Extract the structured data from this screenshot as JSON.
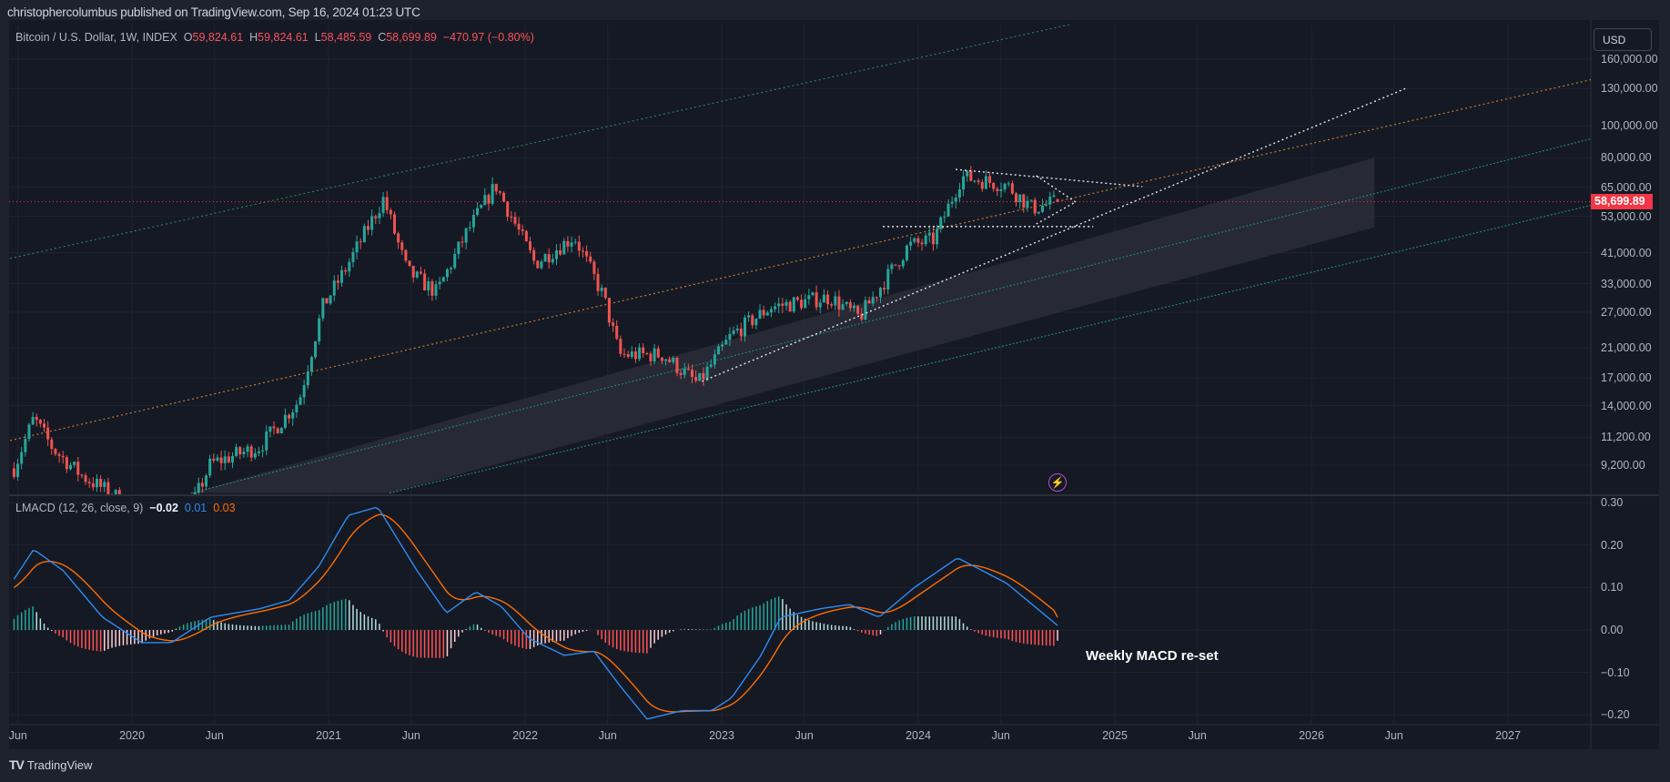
{
  "header": {
    "published": "christophercolumbus published on TradingView.com, Sep 16, 2024 01:23 UTC"
  },
  "legend": {
    "symbol": "Bitcoin / U.S. Dollar, 1W, INDEX",
    "o_label": "O",
    "o": "59,824.61",
    "h_label": "H",
    "h": "59,824.61",
    "l_label": "L",
    "l": "58,485.59",
    "c_label": "C",
    "c": "58,699.89",
    "change": "−470.97 (−0.80%)"
  },
  "currency_button": "USD",
  "current_price_tag": "58,699.89",
  "macd_legend": {
    "name": "LMACD (12, 26, close, 9)",
    "hist": "−0.02",
    "macd": "0.01",
    "signal": "0.03"
  },
  "annotation": "Weekly MACD re-set",
  "footer": {
    "logo_text": "TradingView",
    "logo_mark": "TV"
  },
  "colors": {
    "up": "#26a69a",
    "down": "#ef5350",
    "macd": "#2f8cf0",
    "signal": "#ff6d00",
    "channel_upper": "#2e7d5b",
    "orange_line": "#c77b30",
    "teal_line": "#1f7f7a",
    "band": "#2a2d38",
    "price_line": "#f23645"
  },
  "chart_data": [
    {
      "type": "candlestick",
      "title": "Bitcoin / U.S. Dollar, 1W, INDEX",
      "scale": "log",
      "y_ticks": [
        "160,000.00",
        "130,000.00",
        "100,000.00",
        "80,000.00",
        "65,000.00",
        "53,000.00",
        "41,000.00",
        "33,000.00",
        "27,000.00",
        "21,000.00",
        "17,000.00",
        "14,000.00",
        "11,200.00",
        "9,200.00"
      ],
      "y_tick_values": [
        160000,
        130000,
        100000,
        80000,
        65000,
        53000,
        41000,
        33000,
        27000,
        21000,
        17000,
        14000,
        11200,
        9200
      ],
      "x_ticks": [
        "Jun",
        "2020",
        "Jun",
        "2021",
        "Jun",
        "2022",
        "Jun",
        "2023",
        "Jun",
        "2024",
        "Jun",
        "2025",
        "Jun",
        "2026",
        "Jun",
        "2027"
      ],
      "x_tick_values": [
        2019.42,
        2020,
        2020.42,
        2021,
        2021.42,
        2022,
        2022.42,
        2023,
        2023.42,
        2024,
        2024.42,
        2025,
        2025.42,
        2026,
        2026.42,
        2027
      ],
      "price_path": [
        [
          2019.4,
          9000
        ],
        [
          2019.5,
          12800
        ],
        [
          2019.6,
          10300
        ],
        [
          2019.75,
          8500
        ],
        [
          2019.95,
          7200
        ],
        [
          2020.2,
          5000
        ],
        [
          2020.4,
          9300
        ],
        [
          2020.65,
          10500
        ],
        [
          2020.85,
          14500
        ],
        [
          2020.97,
          28000
        ],
        [
          2021.08,
          36000
        ],
        [
          2021.28,
          60000
        ],
        [
          2021.4,
          36000
        ],
        [
          2021.55,
          31000
        ],
        [
          2021.7,
          47000
        ],
        [
          2021.85,
          66000
        ],
        [
          2022.05,
          38000
        ],
        [
          2022.25,
          46000
        ],
        [
          2022.4,
          30000
        ],
        [
          2022.48,
          20000
        ],
        [
          2022.7,
          20000
        ],
        [
          2022.88,
          16300
        ],
        [
          2023.05,
          23000
        ],
        [
          2023.25,
          28000
        ],
        [
          2023.55,
          30000
        ],
        [
          2023.7,
          26000
        ],
        [
          2023.95,
          43000
        ],
        [
          2024.08,
          45000
        ],
        [
          2024.22,
          70000
        ],
        [
          2024.45,
          66000
        ],
        [
          2024.58,
          56000
        ],
        [
          2024.71,
          58699.89
        ]
      ],
      "last_candle": {
        "open": 59824.61,
        "high": 59824.61,
        "low": 58485.59,
        "close": 58699.89
      },
      "current_price": 58699.89,
      "drawings": {
        "band": [
          [
            2020.3,
            7570
          ],
          [
            2026.32,
            80000
          ],
          [
            2026.32,
            49000
          ],
          [
            2021.31,
            7570
          ]
        ],
        "green_channel": [
          [
            2019.38,
            39400
          ],
          [
            2024.8,
            206000
          ]
        ],
        "orange_line": [
          [
            2019.38,
            10950
          ],
          [
            2027.82,
            157000
          ]
        ],
        "teal_upper": [
          [
            2020.3,
            7570
          ],
          [
            2027.82,
            105000
          ]
        ],
        "teal_lower": [
          [
            2021.31,
            7570
          ],
          [
            2027.82,
            65300
          ]
        ],
        "white_trend": [
          [
            2022.9,
            16600
          ],
          [
            2026.49,
            131000
          ]
        ],
        "triangle_top": [
          [
            2024.19,
            73700
          ],
          [
            2025.14,
            65300
          ]
        ],
        "horizontal_support": [
          [
            2023.82,
            49300
          ],
          [
            2024.89,
            49300
          ]
        ],
        "small_tri_upper": [
          [
            2024.6,
            70500
          ],
          [
            2024.8,
            58600
          ]
        ],
        "small_tri_lower": [
          [
            2024.6,
            50200
          ],
          [
            2024.8,
            58600
          ]
        ]
      }
    },
    {
      "type": "line",
      "title": "LMACD (12, 26, close, 9)",
      "y_ticks": [
        "0.30",
        "0.20",
        "0.10",
        "0.00",
        "−0.10",
        "−0.20"
      ],
      "y_tick_values": [
        0.3,
        0.2,
        0.1,
        0,
        -0.1,
        -0.2
      ],
      "ylim": [
        -0.22,
        0.32
      ],
      "macd_path": [
        [
          2019.4,
          0.12
        ],
        [
          2019.5,
          0.19
        ],
        [
          2019.65,
          0.14
        ],
        [
          2019.85,
          0.03
        ],
        [
          2020.05,
          -0.03
        ],
        [
          2020.2,
          -0.03
        ],
        [
          2020.4,
          0.03
        ],
        [
          2020.65,
          0.05
        ],
        [
          2020.8,
          0.07
        ],
        [
          2020.95,
          0.15
        ],
        [
          2021.1,
          0.27
        ],
        [
          2021.25,
          0.29
        ],
        [
          2021.45,
          0.14
        ],
        [
          2021.6,
          0.04
        ],
        [
          2021.75,
          0.09
        ],
        [
          2021.88,
          0.055
        ],
        [
          2022.02,
          -0.02
        ],
        [
          2022.2,
          -0.06
        ],
        [
          2022.35,
          -0.05
        ],
        [
          2022.48,
          -0.13
        ],
        [
          2022.62,
          -0.21
        ],
        [
          2022.8,
          -0.19
        ],
        [
          2022.95,
          -0.19
        ],
        [
          2023.05,
          -0.16
        ],
        [
          2023.2,
          -0.06
        ],
        [
          2023.3,
          0.03
        ],
        [
          2023.5,
          0.05
        ],
        [
          2023.65,
          0.06
        ],
        [
          2023.8,
          0.03
        ],
        [
          2023.98,
          0.1
        ],
        [
          2024.2,
          0.17
        ],
        [
          2024.45,
          0.11
        ],
        [
          2024.71,
          0.01
        ]
      ]
    }
  ]
}
